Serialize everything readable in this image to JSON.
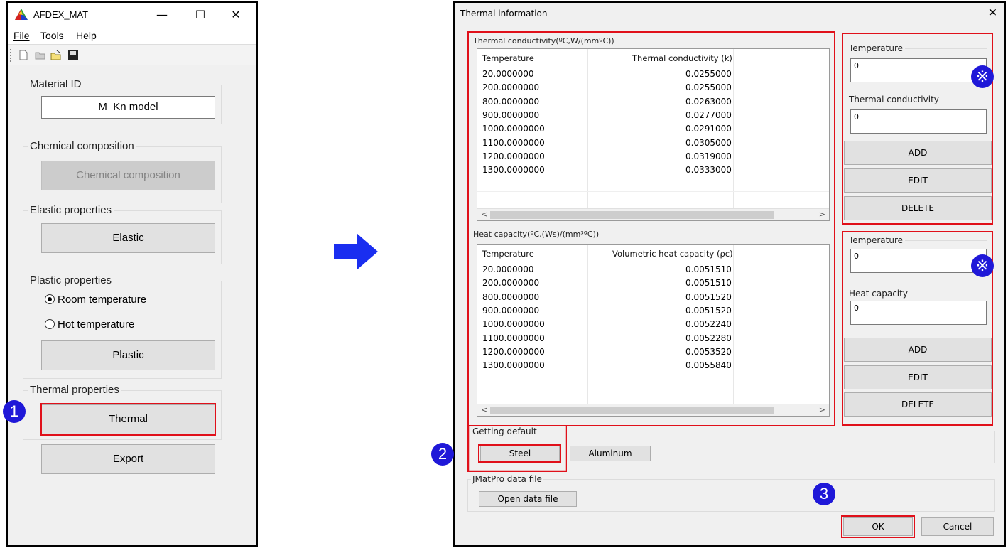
{
  "left_window": {
    "title": "AFDEX_MAT",
    "controls": {
      "minimize": "—",
      "maximize": "☐",
      "close": "✕"
    },
    "menu": {
      "file": "File",
      "tools": "Tools",
      "help": "Help"
    },
    "material_id": {
      "label": "Material ID",
      "value": "M_Kn model"
    },
    "chemical": {
      "label": "Chemical composition",
      "button": "Chemical composition"
    },
    "elastic": {
      "label": "Elastic properties",
      "button": "Elastic"
    },
    "plastic": {
      "label": "Plastic properties",
      "room": "Room temperature",
      "hot": "Hot temperature",
      "button": "Plastic"
    },
    "thermal": {
      "label": "Thermal properties",
      "button": "Thermal"
    },
    "export_button": "Export"
  },
  "badges": {
    "one": "1",
    "two": "2",
    "three": "3",
    "note": "※"
  },
  "dialog": {
    "title": "Thermal information",
    "close": "✕",
    "conductivity": {
      "label": "Thermal conductivity(ºC,W/(mmºC))",
      "col_temp": "Temperature",
      "col_value": "Thermal conductivity (k)",
      "rows": [
        [
          "20.0000000",
          "0.0255000"
        ],
        [
          "200.0000000",
          "0.0255000"
        ],
        [
          "800.0000000",
          "0.0263000"
        ],
        [
          "900.0000000",
          "0.0277000"
        ],
        [
          "1000.0000000",
          "0.0291000"
        ],
        [
          "1100.0000000",
          "0.0305000"
        ],
        [
          "1200.0000000",
          "0.0319000"
        ],
        [
          "1300.0000000",
          "0.0333000"
        ]
      ]
    },
    "capacity": {
      "label": "Heat capacity(ºC,(Ws)/(mm³ºC))",
      "col_temp": "Temperature",
      "col_value": "Volumetric heat capacity (ρc)",
      "rows": [
        [
          "20.0000000",
          "0.0051510"
        ],
        [
          "200.0000000",
          "0.0051510"
        ],
        [
          "800.0000000",
          "0.0051520"
        ],
        [
          "900.0000000",
          "0.0051520"
        ],
        [
          "1000.0000000",
          "0.0052240"
        ],
        [
          "1100.0000000",
          "0.0052280"
        ],
        [
          "1200.0000000",
          "0.0053520"
        ],
        [
          "1300.0000000",
          "0.0055840"
        ]
      ]
    },
    "cond_editor": {
      "temp_label": "Temperature",
      "temp_value": "0",
      "value_label": "Thermal conductivity",
      "value_value": "0",
      "add": "ADD",
      "edit": "EDIT",
      "delete": "DELETE"
    },
    "cap_editor": {
      "temp_label": "Temperature",
      "temp_value": "0",
      "value_label": "Heat capacity",
      "value_value": "0",
      "add": "ADD",
      "edit": "EDIT",
      "delete": "DELETE"
    },
    "default": {
      "label": "Getting default",
      "steel": "Steel",
      "aluminum": "Aluminum"
    },
    "jmatpro": {
      "label": "JMatPro data file",
      "open": "Open data file"
    },
    "ok": "OK",
    "cancel": "Cancel"
  },
  "colors": {
    "highlight": "#e0101a",
    "badge": "#1f18d8",
    "arrow": "#1a2ef0"
  }
}
